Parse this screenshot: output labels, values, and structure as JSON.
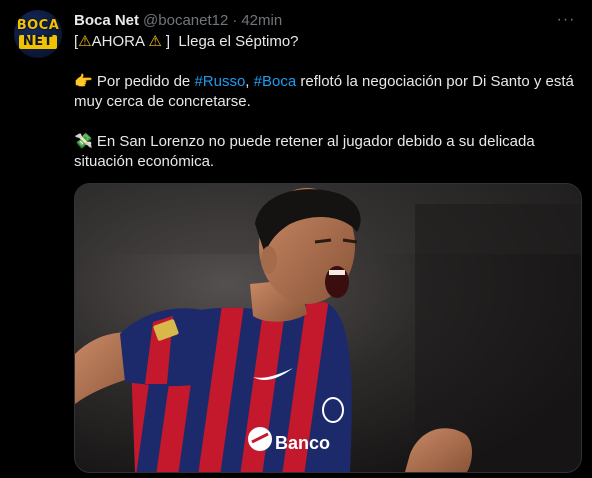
{
  "tweet": {
    "avatar": {
      "line1": "BOCA",
      "line2": "NET"
    },
    "author_name": "Boca Net",
    "author_handle": "@bocanet12",
    "separator": "·",
    "time": "42min",
    "more_icon": "···",
    "line1": {
      "open_bracket": "[",
      "warning_emoji": "⚠",
      "ahora": "AHORA",
      "warning_emoji2": "⚠",
      "rest": " ]  Llega el Séptimo?"
    },
    "para2": {
      "pointing_emoji": "👉",
      "text_a": " Por pedido de ",
      "hashtag1": "#Russo",
      "comma": ", ",
      "hashtag2": "#Boca",
      "text_b": " reflotó la negociación por Di Santo y está muy cerca de concretarse."
    },
    "para3": {
      "money_emoji": "💸",
      "text": " En San Lorenzo no puede retener al jugador debido a su delicada situación económica."
    },
    "media": {
      "alt_icon": "player-photo",
      "shirt_sponsor": "Banco"
    }
  }
}
